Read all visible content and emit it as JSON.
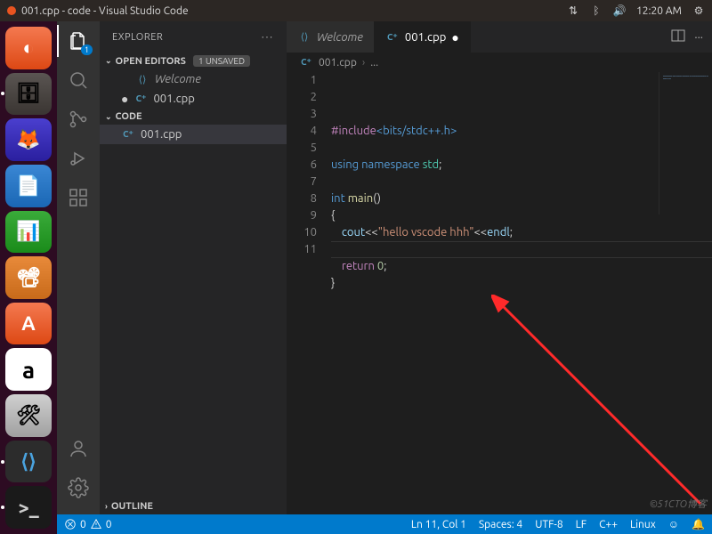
{
  "ubuntu_top": {
    "title": "001.cpp - code - Visual Studio Code",
    "time": "12:20 AM"
  },
  "launcher": [
    {
      "name": "ubuntu-dash",
      "glyph": "◐"
    },
    {
      "name": "files",
      "glyph": "🗄"
    },
    {
      "name": "firefox",
      "glyph": "🦊"
    },
    {
      "name": "libre-writer",
      "glyph": "📄"
    },
    {
      "name": "libre-calc",
      "glyph": "📊"
    },
    {
      "name": "libre-impress",
      "glyph": "📽"
    },
    {
      "name": "ubuntu-software",
      "glyph": "A"
    },
    {
      "name": "amazon",
      "glyph": "a"
    },
    {
      "name": "settings-tool",
      "glyph": "🛠"
    },
    {
      "name": "vscode",
      "glyph": "⟨⟩"
    },
    {
      "name": "terminal",
      "glyph": ">_"
    }
  ],
  "explorer": {
    "title": "EXPLORER",
    "open_editors_label": "OPEN EDITORS",
    "unsaved_pill": "1 UNSAVED",
    "workspace_label": "CODE",
    "outline_label": "OUTLINE",
    "open_editors": [
      {
        "icon": "vs",
        "label": "Welcome",
        "italic": true,
        "dirty": false
      },
      {
        "icon": "cpp",
        "label": "001.cpp",
        "italic": false,
        "dirty": true
      }
    ],
    "files": [
      {
        "icon": "cpp",
        "label": "001.cpp",
        "selected": true
      }
    ]
  },
  "tabs": [
    {
      "icon": "vs",
      "label": "Welcome",
      "active": false,
      "italic": true,
      "dirty": false
    },
    {
      "icon": "cpp",
      "label": "001.cpp",
      "active": true,
      "italic": false,
      "dirty": true
    }
  ],
  "breadcrumbs": [
    "001.cpp",
    "..."
  ],
  "code_lines": [
    {
      "n": 1,
      "tokens": [
        [
          "pre",
          "#include"
        ],
        [
          "inc",
          "<bits/stdc++.h>"
        ]
      ]
    },
    {
      "n": 2,
      "tokens": []
    },
    {
      "n": 3,
      "tokens": [
        [
          "kw",
          "using"
        ],
        [
          "op",
          " "
        ],
        [
          "kw",
          "namespace"
        ],
        [
          "op",
          " "
        ],
        [
          "ns",
          "std"
        ],
        [
          "op",
          ";"
        ]
      ]
    },
    {
      "n": 4,
      "tokens": []
    },
    {
      "n": 5,
      "tokens": [
        [
          "type",
          "int"
        ],
        [
          "op",
          " "
        ],
        [
          "fn",
          "main"
        ],
        [
          "op",
          "()"
        ]
      ]
    },
    {
      "n": 6,
      "tokens": [
        [
          "op",
          "{"
        ]
      ]
    },
    {
      "n": 7,
      "tokens": [
        [
          "op",
          "    "
        ],
        [
          "id",
          "cout"
        ],
        [
          "op",
          "<<"
        ],
        [
          "str",
          "\"hello vscode hhh\""
        ],
        [
          "op",
          "<<"
        ],
        [
          "id",
          "endl"
        ],
        [
          "op",
          ";"
        ]
      ]
    },
    {
      "n": 8,
      "tokens": []
    },
    {
      "n": 9,
      "tokens": [
        [
          "op",
          "    "
        ],
        [
          "flow",
          "return"
        ],
        [
          "op",
          " "
        ],
        [
          "num",
          "0"
        ],
        [
          "op",
          ";"
        ]
      ]
    },
    {
      "n": 10,
      "tokens": [
        [
          "op",
          "}"
        ]
      ]
    },
    {
      "n": 11,
      "tokens": []
    }
  ],
  "status": {
    "errors": "0",
    "warnings": "0",
    "ln_col": "Ln 11, Col 1",
    "spaces": "Spaces: 4",
    "encoding": "UTF-8",
    "eol": "LF",
    "lang": "C++",
    "os": "Linux"
  },
  "watermark": "©51CTO博客",
  "activity_badge": "1"
}
